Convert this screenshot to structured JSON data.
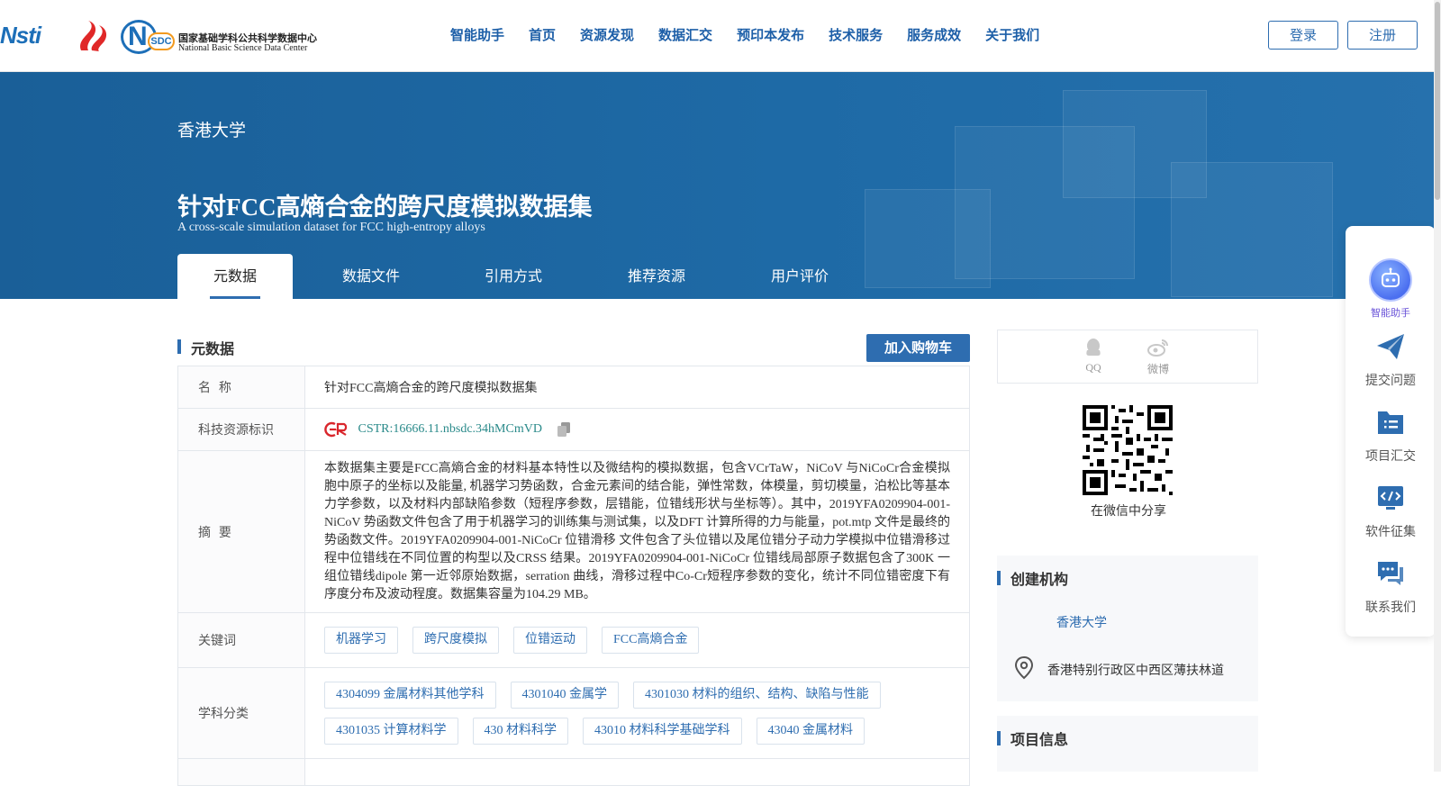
{
  "header": {
    "logo1_text": "Nsti",
    "logo3_cn": "国家基础学科公共科学数据中心",
    "logo3_en": "National Basic Science Data Center",
    "logo3_badge": "SDC",
    "logo3_letter": "N",
    "nav": [
      "智能助手",
      "首页",
      "资源发现",
      "数据汇交",
      "预印本发布",
      "技术服务",
      "服务成效",
      "关于我们"
    ],
    "login": "登录",
    "register": "注册"
  },
  "banner": {
    "org": "香港大学",
    "title_cn": "针对FCC高熵合金的跨尺度模拟数据集",
    "title_en": "A cross-scale simulation dataset for FCC high-entropy alloys",
    "tabs": [
      "元数据",
      "数据文件",
      "引用方式",
      "推荐资源",
      "用户评价"
    ]
  },
  "main": {
    "section_title": "元数据",
    "cart_button": "加入购物车",
    "rows": {
      "name_key": "名  称",
      "name_val": "针对FCC高熵合金的跨尺度模拟数据集",
      "id_key": "科技资源标识",
      "id_val": "CSTR:16666.11.nbsdc.34hMCmVD",
      "abstract_key": "摘  要",
      "abstract_val": "本数据集主要是FCC高熵合金的材料基本特性以及微结构的模拟数据，包含VCrTaW，NiCoV 与NiCoCr合金模拟胞中原子的坐标以及能量, 机器学习势函数，合金元素间的结合能，弹性常数，体模量，剪切模量，泊松比等基本力学参数，以及材料内部缺陷参数（短程序参数，层错能，位错线形状与坐标等）。其中，2019YFA0209904-001-NiCoV 势函数文件包含了用于机器学习的训练集与测试集，以及DFT 计算所得的力与能量，pot.mtp 文件是最终的势函数文件。2019YFA0209904-001-NiCoCr 位错滑移 文件包含了头位错以及尾位错分子动力学模拟中位错滑移过程中位错线在不同位置的构型以及CRSS 结果。2019YFA0209904-001-NiCoCr 位错线局部原子数据包含了300K 一组位错线dipole 第一近邻原始数据，serration 曲线，滑移过程中Co-Cr短程序参数的变化，统计不同位错密度下有序度分布及波动程度。数据集容量为104.29 MB。",
      "keywords_key": "关键词",
      "keywords": [
        "机器学习",
        "跨尺度模拟",
        "位错运动",
        "FCC高熵合金"
      ],
      "subjects_key": "学科分类",
      "subjects_row1": [
        "4304099 金属材料其他学科",
        "4301040 金属学",
        "4301030 材料的组织、结构、缺陷与性能"
      ],
      "subjects_row2": [
        "4301035 计算材料学",
        "430 材料科学",
        "43010 材料科学基础学科",
        "43040 金属材料"
      ]
    }
  },
  "side": {
    "share_qq": "QQ",
    "share_weibo": "微博",
    "qr_label": "在微信中分享",
    "org_card_title": "创建机构",
    "org_name": "香港大学",
    "org_address": "香港特别行政区中西区薄扶林道",
    "project_card_title": "项目信息"
  },
  "float": {
    "items": [
      "智能助手",
      "提交问题",
      "项目汇交",
      "软件征集",
      "联系我们"
    ],
    "accent": "#2e6db0"
  }
}
